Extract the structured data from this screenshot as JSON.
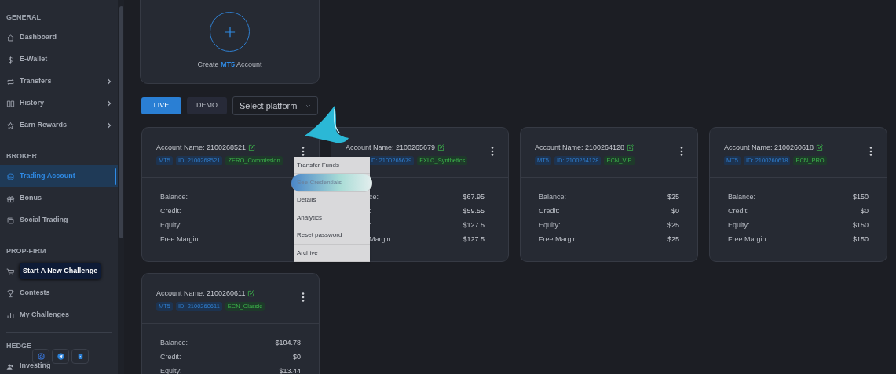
{
  "sidebar": {
    "sections": [
      {
        "title": "GENERAL",
        "items": [
          {
            "label": "Dashboard",
            "chevron": false,
            "selected": false
          },
          {
            "label": "E-Wallet",
            "chevron": false,
            "selected": false
          },
          {
            "label": "Transfers",
            "chevron": true,
            "selected": false
          },
          {
            "label": "History",
            "chevron": true,
            "selected": false
          },
          {
            "label": "Earn Rewards",
            "chevron": true,
            "selected": false
          }
        ]
      },
      {
        "title": "BROKER",
        "items": [
          {
            "label": "Trading Account",
            "chevron": false,
            "selected": true
          },
          {
            "label": "Bonus",
            "chevron": false,
            "selected": false
          },
          {
            "label": "Social Trading",
            "chevron": false,
            "selected": false
          }
        ]
      },
      {
        "title": "PROP-FIRM",
        "items": [
          {
            "label": "Start A New Challenge",
            "chevron": false,
            "selected": false,
            "kind": "highlight"
          },
          {
            "label": "Contests",
            "chevron": false,
            "selected": false,
            "kind": "plain"
          },
          {
            "label": "My Challenges",
            "chevron": false,
            "selected": false,
            "kind": "plain"
          }
        ]
      },
      {
        "title": "HEDGE",
        "items": [
          {
            "label": "Investing",
            "chevron": false,
            "selected": false
          }
        ]
      }
    ]
  },
  "create_card": {
    "before": "Create ",
    "highlight": "MT5",
    "after": " Account"
  },
  "filters": {
    "tabs": [
      {
        "label": "LIVE",
        "selected": true
      },
      {
        "label": "DEMO",
        "selected": false
      }
    ],
    "platform_select": {
      "placeholder": "Select platform"
    }
  },
  "accounts": [
    {
      "name": "Account Name: 2100268521",
      "badges": [
        {
          "text": "MT5",
          "kind": "platform"
        },
        {
          "text": "ID: 2100268521",
          "kind": "id"
        },
        {
          "text": "ZERO_Commission",
          "kind": "plan"
        }
      ],
      "rows": [
        {
          "label": "Balance:"
        },
        {
          "label": "Credit:"
        },
        {
          "label": "Equity:"
        },
        {
          "label": "Free Margin:"
        }
      ],
      "menu": [
        {
          "label": "Transfer Funds",
          "selected": false
        },
        {
          "label": "See Credentials",
          "selected": true
        },
        {
          "label": "Details",
          "selected": false
        },
        {
          "label": "Analytics",
          "selected": false
        },
        {
          "label": "Reset password",
          "selected": false
        },
        {
          "label": "Archive",
          "selected": false
        }
      ]
    },
    {
      "name": "Account Name: 2100265679",
      "badges": [
        {
          "text": "D: 2100265679",
          "kind": "id"
        },
        {
          "text": "FXLC_Synthetics",
          "kind": "plan"
        }
      ],
      "rows": [
        {
          "label": "ce:",
          "value": "$67.95"
        },
        {
          "label": ":",
          "value": "$59.55"
        },
        {
          "label": ":",
          "value": "$127.5"
        },
        {
          "label": "Margin:",
          "value": "$127.5"
        }
      ]
    },
    {
      "name": "Account Name: 2100264128",
      "badges": [
        {
          "text": "MT5",
          "kind": "platform"
        },
        {
          "text": "ID: 2100264128",
          "kind": "id"
        },
        {
          "text": "ECN_VIP",
          "kind": "plan"
        }
      ],
      "rows": [
        {
          "label": "Balance:",
          "value": "$25"
        },
        {
          "label": "Credit:",
          "value": "$0"
        },
        {
          "label": "Equity:",
          "value": "$25"
        },
        {
          "label": "Free Margin:",
          "value": "$25"
        }
      ]
    },
    {
      "name": "Account Name: 2100260618",
      "badges": [
        {
          "text": "MT5",
          "kind": "platform"
        },
        {
          "text": "ID: 2100260618",
          "kind": "id"
        },
        {
          "text": "ECN_PRO",
          "kind": "plan"
        }
      ],
      "rows": [
        {
          "label": "Balance:",
          "value": "$150"
        },
        {
          "label": "Credit:",
          "value": "$0"
        },
        {
          "label": "Equity:",
          "value": "$150"
        },
        {
          "label": "Free Margin:",
          "value": "$150"
        }
      ]
    },
    {
      "name": "Account Name: 2100260611",
      "badges": [
        {
          "text": "MT5",
          "kind": "platform"
        },
        {
          "text": "ID: 2100260611",
          "kind": "id"
        },
        {
          "text": "ECN_Classic",
          "kind": "plan"
        }
      ],
      "rows": [
        {
          "label": "Balance:",
          "value": "$104.78"
        },
        {
          "label": "Credit:",
          "value": "$0"
        },
        {
          "label": "Equity:",
          "value": "$13.44"
        }
      ]
    }
  ]
}
